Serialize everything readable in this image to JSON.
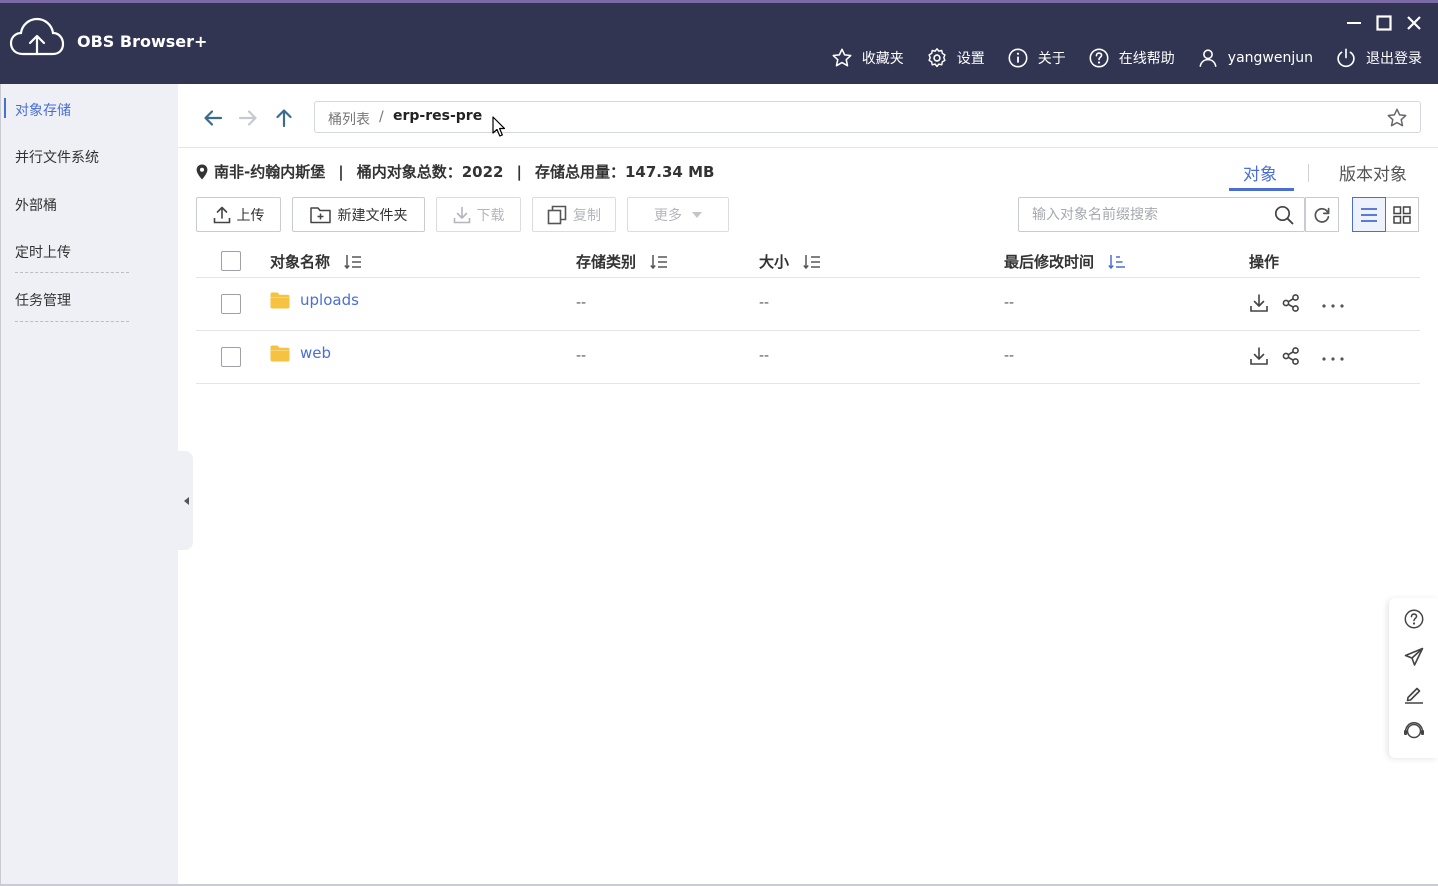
{
  "app": {
    "title": "OBS Browser+"
  },
  "header": {
    "menu": [
      {
        "label": "收藏夹",
        "icon": "star-icon"
      },
      {
        "label": "设置",
        "icon": "gear-icon"
      },
      {
        "label": "关于",
        "icon": "info-icon"
      },
      {
        "label": "在线帮助",
        "icon": "help-icon"
      },
      {
        "label": "yangwenjun",
        "icon": "user-icon"
      },
      {
        "label": "退出登录",
        "icon": "power-icon"
      }
    ]
  },
  "sidebar": {
    "items": [
      {
        "label": "对象存储",
        "active": true
      },
      {
        "label": "并行文件系统"
      },
      {
        "label": "外部桶"
      },
      {
        "label": "定时上传"
      },
      {
        "label": "任务管理"
      }
    ]
  },
  "address": {
    "root": "桶列表",
    "separator": "/",
    "current": "erp-res-pre"
  },
  "info": {
    "region": "南非-约翰内斯堡",
    "count_label": "桶内对象总数：",
    "count_value": "2022",
    "storage_label": "存储总用量：",
    "storage_value": "147.34 MB",
    "separator": "|"
  },
  "tabs": [
    {
      "label": "对象",
      "active": true
    },
    {
      "label": "版本对象"
    }
  ],
  "toolbar": {
    "upload": "上传",
    "new_folder": "新建文件夹",
    "download": "下载",
    "copy": "复制",
    "more": "更多",
    "search_placeholder": "输入对象名前缀搜索"
  },
  "table": {
    "headers": {
      "name": "对象名称",
      "storage_class": "存储类别",
      "size": "大小",
      "modified": "最后修改时间",
      "actions": "操作"
    },
    "rows": [
      {
        "name": "uploads",
        "storage_class": "--",
        "size": "--",
        "modified": "--"
      },
      {
        "name": "web",
        "storage_class": "--",
        "size": "--",
        "modified": "--"
      }
    ]
  },
  "colors": {
    "accent": "#4a6ed4",
    "header_bg": "#313552",
    "folder": "#f5c242",
    "sidebar_bg": "#eef0f6"
  }
}
